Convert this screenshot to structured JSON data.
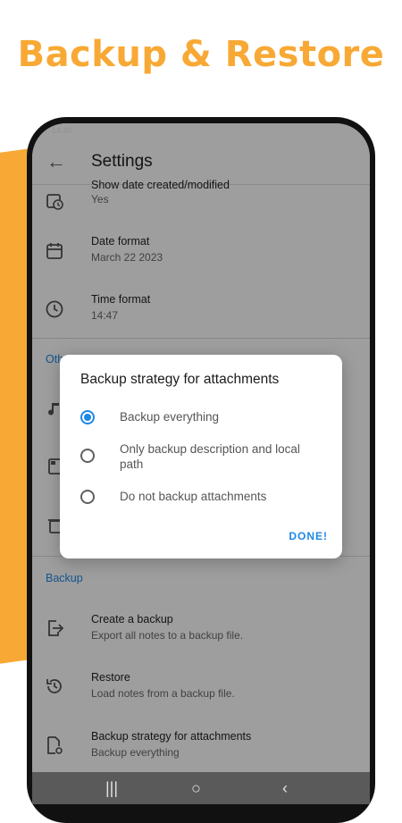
{
  "promo": {
    "title": "Backup & Restore"
  },
  "status_bar": {
    "time": "14:40",
    "right": ""
  },
  "app_bar": {
    "title": "Settings"
  },
  "settings": {
    "show_date": {
      "title": "Show date created/modified",
      "value": "Yes"
    },
    "date_format": {
      "title": "Date format",
      "value": "March 22 2023"
    },
    "time_format": {
      "title": "Time format",
      "value": "14:47"
    },
    "other_section": "Oth",
    "backup_section": "Backup",
    "create_backup": {
      "title": "Create a backup",
      "value": "Export all notes to a backup file."
    },
    "restore": {
      "title": "Restore",
      "value": "Load notes from a backup file."
    },
    "backup_strategy": {
      "title": "Backup strategy for attachments",
      "value": "Backup everything"
    }
  },
  "dialog": {
    "title": "Backup strategy for attachments",
    "options": [
      {
        "label": "Backup everything",
        "selected": true
      },
      {
        "label": "Only backup description and local path",
        "selected": false
      },
      {
        "label": "Do not backup attachments",
        "selected": false
      }
    ],
    "done_label": "DONE!"
  },
  "colors": {
    "accent": "#f8a935",
    "primary": "#1e88e5"
  },
  "nav_bar": {
    "recents": "|||",
    "home": "○",
    "back": "‹"
  }
}
